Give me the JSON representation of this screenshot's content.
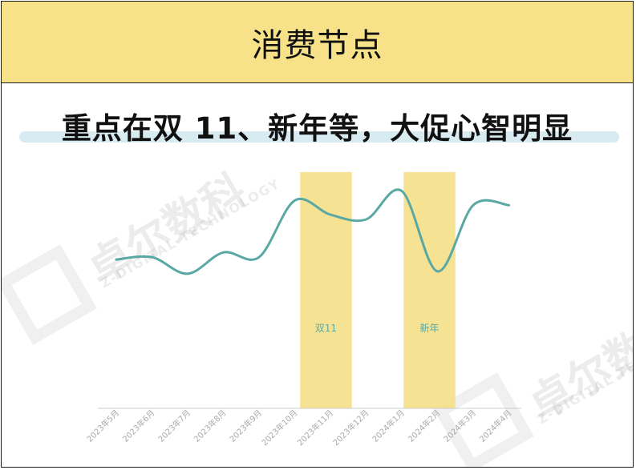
{
  "header": {
    "title": "消费节点"
  },
  "subtitle": "重点在双 11、新年等，大促心智明显",
  "watermark": {
    "brand": "卓尔数科",
    "tagline": "Z-DIGITAL TECHNOLOGY"
  },
  "colors": {
    "header_bg": "#f7e189",
    "line": "#5aa8a4",
    "highlight": "#f5e08a",
    "axis": "#cccccc"
  },
  "chart_data": {
    "type": "line",
    "title": "",
    "xlabel": "",
    "ylabel": "",
    "grid": false,
    "categories": [
      "2023年5月",
      "2023年6月",
      "2023年7月",
      "2023年8月",
      "2023年9月",
      "2023年10月",
      "2023年11月",
      "2023年12月",
      "2024年1月",
      "2024年2月",
      "2024年3月",
      "2024年4月"
    ],
    "series": [
      {
        "values": [
          63,
          64,
          57,
          66,
          64,
          88,
          82,
          80,
          92,
          58,
          86,
          86
        ]
      }
    ],
    "y_axis_shown": false,
    "ylim": [
      0,
      100
    ],
    "highlight_bands": [
      {
        "label": "双11",
        "from_index": 5.15,
        "to_index": 6.6
      },
      {
        "label": "新年",
        "from_index": 8.05,
        "to_index": 9.5
      }
    ]
  }
}
